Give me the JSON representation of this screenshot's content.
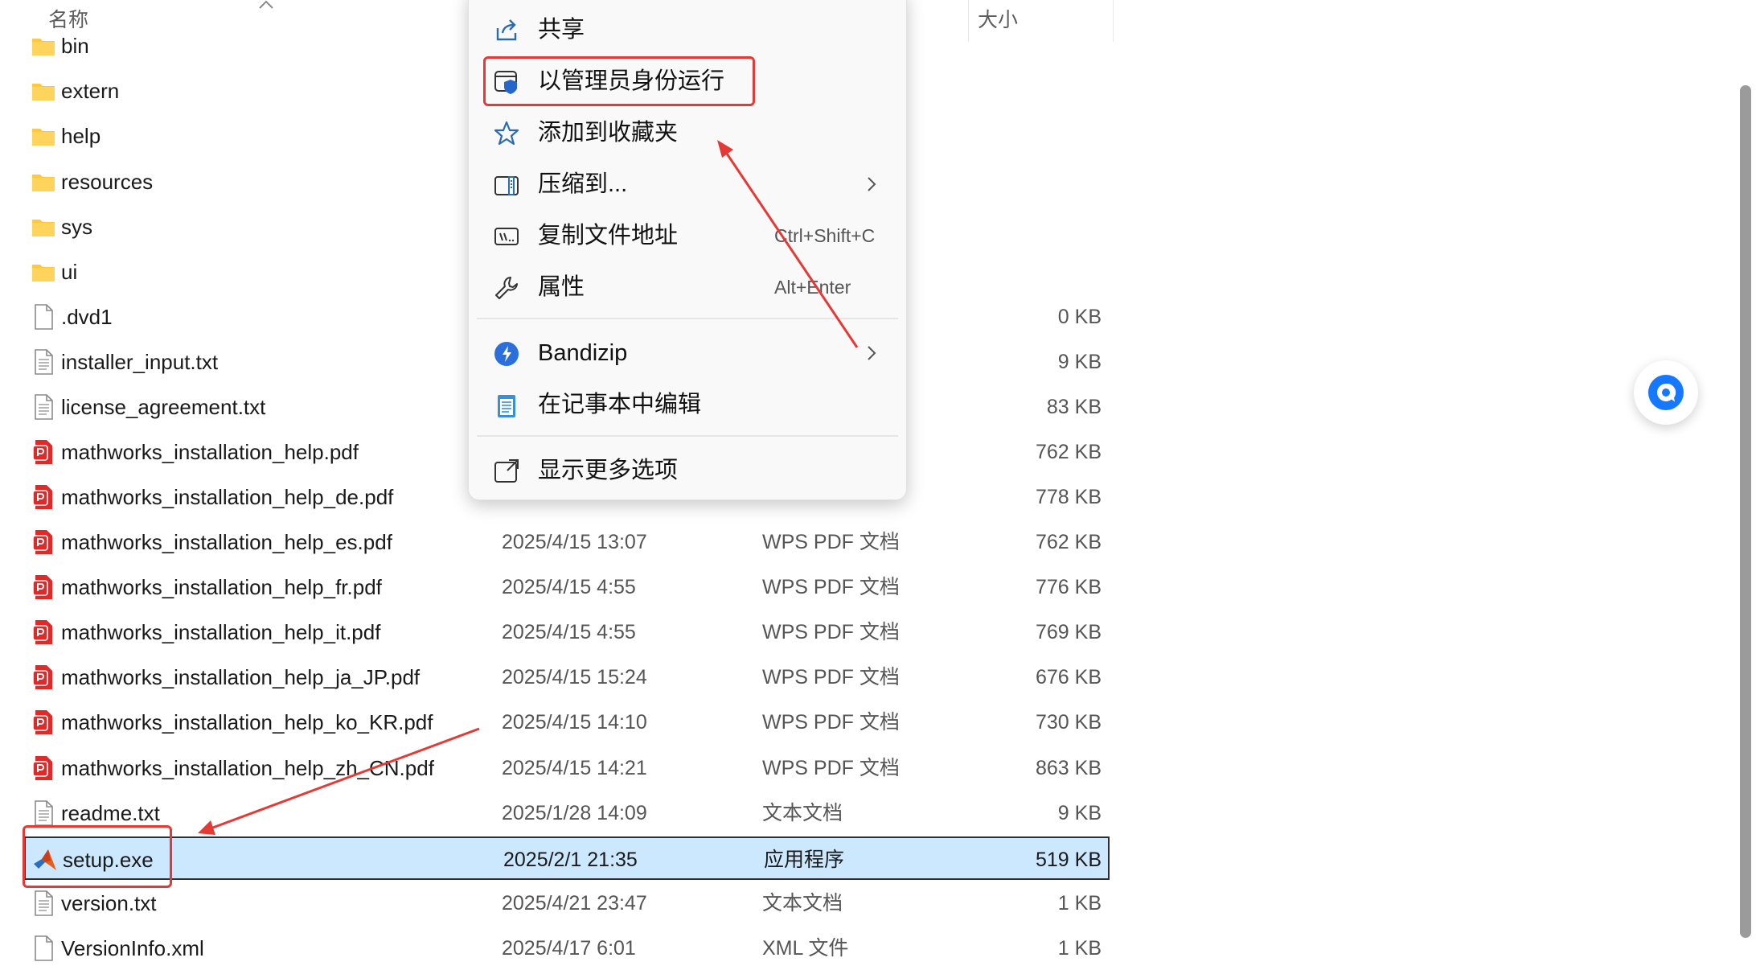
{
  "header": {
    "name_column": "名称",
    "size_column": "大小"
  },
  "files": [
    {
      "name": "bin",
      "date": "",
      "type": "",
      "size": "",
      "icon": "folder-icon"
    },
    {
      "name": "extern",
      "date": "",
      "type": "",
      "size": "",
      "icon": "folder-icon"
    },
    {
      "name": "help",
      "date": "",
      "type": "",
      "size": "",
      "icon": "folder-icon"
    },
    {
      "name": "resources",
      "date": "",
      "type": "",
      "size": "",
      "icon": "folder-icon"
    },
    {
      "name": "sys",
      "date": "",
      "type": "",
      "size": "",
      "icon": "folder-icon"
    },
    {
      "name": "ui",
      "date": "",
      "type": "",
      "size": "",
      "icon": "folder-icon"
    },
    {
      "name": ".dvd1",
      "date": "",
      "type": "",
      "size": "0 KB",
      "icon": "blank-file-icon"
    },
    {
      "name": "installer_input.txt",
      "date": "",
      "type": "",
      "size": "9 KB",
      "icon": "text-file-icon"
    },
    {
      "name": "license_agreement.txt",
      "date": "",
      "type": "",
      "size": "83 KB",
      "icon": "text-file-icon"
    },
    {
      "name": "mathworks_installation_help.pdf",
      "date": "",
      "type": "",
      "size": "762 KB",
      "icon": "pdf-icon"
    },
    {
      "name": "mathworks_installation_help_de.pdf",
      "date": "",
      "type": "",
      "size": "778 KB",
      "icon": "pdf-icon"
    },
    {
      "name": "mathworks_installation_help_es.pdf",
      "date": "2025/4/15 13:07",
      "type": "WPS PDF 文档",
      "size": "762 KB",
      "icon": "pdf-icon"
    },
    {
      "name": "mathworks_installation_help_fr.pdf",
      "date": "2025/4/15 4:55",
      "type": "WPS PDF 文档",
      "size": "776 KB",
      "icon": "pdf-icon"
    },
    {
      "name": "mathworks_installation_help_it.pdf",
      "date": "2025/4/15 4:55",
      "type": "WPS PDF 文档",
      "size": "769 KB",
      "icon": "pdf-icon"
    },
    {
      "name": "mathworks_installation_help_ja_JP.pdf",
      "date": "2025/4/15 15:24",
      "type": "WPS PDF 文档",
      "size": "676 KB",
      "icon": "pdf-icon"
    },
    {
      "name": "mathworks_installation_help_ko_KR.pdf",
      "date": "2025/4/15 14:10",
      "type": "WPS PDF 文档",
      "size": "730 KB",
      "icon": "pdf-icon"
    },
    {
      "name": "mathworks_installation_help_zh_CN.pdf",
      "date": "2025/4/15 14:21",
      "type": "WPS PDF 文档",
      "size": "863 KB",
      "icon": "pdf-icon"
    },
    {
      "name": "readme.txt",
      "date": "2025/1/28 14:09",
      "type": "文本文档",
      "size": "9 KB",
      "icon": "text-file-icon"
    },
    {
      "name": "setup.exe",
      "date": "2025/2/1 21:35",
      "type": "应用程序",
      "size": "519 KB",
      "icon": "matlab-icon",
      "selected": true
    },
    {
      "name": "version.txt",
      "date": "2025/4/21 23:47",
      "type": "文本文档",
      "size": "1 KB",
      "icon": "text-file-icon"
    },
    {
      "name": "VersionInfo.xml",
      "date": "2025/4/17 6:01",
      "type": "XML 文件",
      "size": "1 KB",
      "icon": "blank-file-icon"
    }
  ],
  "context_menu": {
    "share": {
      "label": "共享",
      "icon": "share-icon"
    },
    "run_as_admin": {
      "label": "以管理员身份运行",
      "icon": "shield-icon"
    },
    "add_favorite": {
      "label": "添加到收藏夹",
      "icon": "star-icon"
    },
    "compress": {
      "label": "压缩到...",
      "icon": "zip-icon"
    },
    "copy_path": {
      "label": "复制文件地址",
      "shortcut": "Ctrl+Shift+C",
      "icon": "copy-path-icon"
    },
    "properties": {
      "label": "属性",
      "shortcut": "Alt+Enter",
      "icon": "wrench-icon"
    },
    "bandizip": {
      "label": "Bandizip",
      "icon": "bandizip-icon"
    },
    "notepad": {
      "label": "在记事本中编辑",
      "icon": "notepad-icon"
    },
    "more_options": {
      "label": "显示更多选项",
      "icon": "more-options-icon"
    }
  },
  "colors": {
    "selection": "#cce8ff",
    "annotation_red": "#e53935",
    "folder": "#ffc83d",
    "pdf_red": "#e02a2a"
  }
}
